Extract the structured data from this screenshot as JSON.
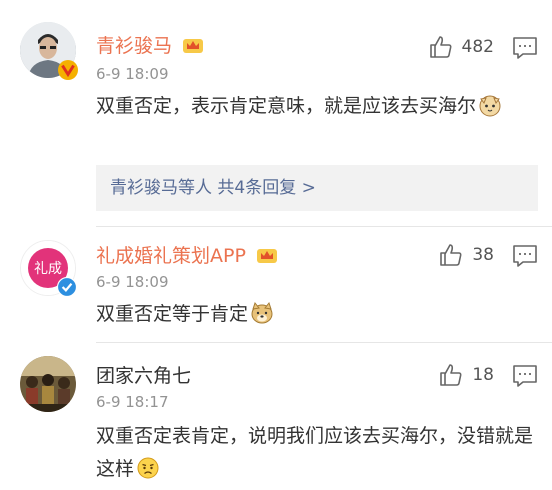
{
  "comments": [
    {
      "username": "青衫骏马",
      "time": "6-9 18:09",
      "text": "双重否定，表示肯定意味，就是应该去买海尔",
      "likes": "482",
      "reply_summary": "青衫骏马等人 共4条回复 >"
    },
    {
      "username": "礼成婚礼策划APP",
      "avatar_text": "礼成",
      "time": "6-9 18:09",
      "text": "双重否定等于肯定",
      "likes": "38"
    },
    {
      "username": "团家六角七",
      "time": "6-9 18:17",
      "text": "双重否定表肯定，说明我们应该去买海尔，没错就是这样",
      "likes": "18"
    }
  ],
  "colors": {
    "vip_name": "#eb7350",
    "reply_link": "#576b95",
    "time": "#939393",
    "brand_pink": "#e2337a"
  },
  "icons": [
    "crown-icon",
    "thumbs-up-icon",
    "comment-icon",
    "verified-icon",
    "emoji-cat-icon",
    "emoji-doge-icon",
    "emoji-sad-icon"
  ]
}
